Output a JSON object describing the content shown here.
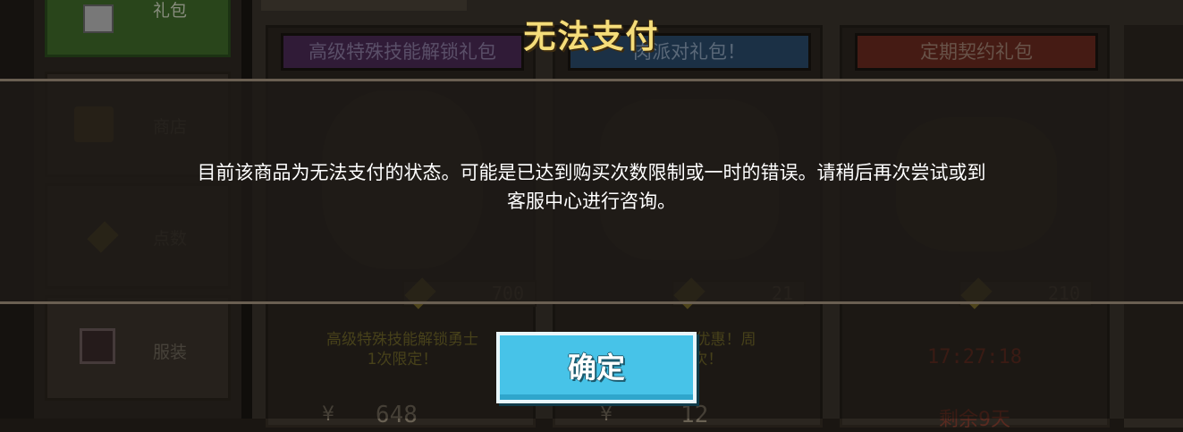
{
  "sidebar": {
    "items": [
      {
        "label": "礼包",
        "icon": "gift-icon"
      },
      {
        "label": "商店",
        "icon": "coins-icon"
      },
      {
        "label": "点数",
        "icon": "ticket-icon"
      },
      {
        "label": "服装",
        "icon": "costume-icon"
      }
    ]
  },
  "cards": [
    {
      "title": "高级特殊技能解锁礼包",
      "price": "700",
      "desc_line1": "高级特殊技能解锁勇士",
      "desc_line2": "1次限定！",
      "currency": "¥",
      "amount": "648",
      "banner_color": "#4a2a55"
    },
    {
      "title": "肉派对礼包！",
      "price": "21",
      "desc_line1": "…进行优惠！周",
      "desc_line2": "2次！",
      "currency": "¥",
      "amount": "12",
      "banner_color": "#2a4a6a"
    },
    {
      "title": "定期契约礼包",
      "price": "210",
      "timer": "17:27:18",
      "remaining": "剩余9天",
      "banner_color": "#6a2a20"
    }
  ],
  "dialog": {
    "title": "无法支付",
    "message_line1": "目前该商品为无法支付的状态。可能是已达到购买次数限制或一时的错误。请稍后再次尝试或到",
    "message_line2": "客服中心进行咨询。",
    "confirm_label": "确定"
  },
  "colors": {
    "title_gold": "#f5dd7a",
    "button_blue": "#47c3e8"
  }
}
